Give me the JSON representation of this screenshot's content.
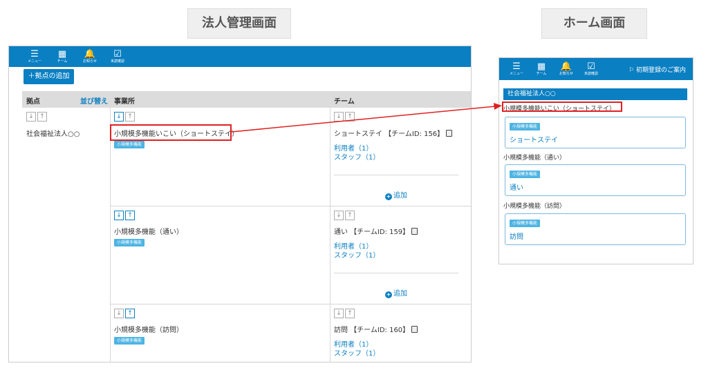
{
  "titles": {
    "corp_screen": "法人管理画面",
    "home_screen": "ホーム画面"
  },
  "topbar": {
    "items": [
      {
        "icon": "menu-icon",
        "glyph": "☰",
        "label": "メニュー"
      },
      {
        "icon": "team-grid-icon",
        "glyph": "▦",
        "label": "チーム"
      },
      {
        "icon": "bell-icon",
        "glyph": "🔔",
        "label": "お知らせ"
      },
      {
        "icon": "clipboard-check-icon",
        "glyph": "☑",
        "label": "未読確認"
      }
    ]
  },
  "corp": {
    "add_base_button": "＋拠点の追加",
    "headers": {
      "base": "拠点",
      "sort": "並び替え",
      "office": "事業所",
      "team": "チーム"
    },
    "base_name": "社会福祉法人○○",
    "arrow_down": "↓",
    "arrow_up": "↑",
    "facility_badge": "小規模多機能",
    "users_link": "利用者（1）",
    "staff_link": "スタッフ（1）",
    "add_label": "追加",
    "rows": [
      {
        "office": "小規模多機能いこい（ショートステイ）",
        "team": "ショートステイ 【チームID: 156】"
      },
      {
        "office": "小規模多機能（通い）",
        "team": "通い 【チームID: 159】"
      },
      {
        "office": "小規模多機能（訪問）",
        "team": "訪問 【チームID: 160】"
      }
    ]
  },
  "home": {
    "guide_link": "⚐ 初期登録のご案内",
    "corp_name": "社会福祉法人○○",
    "facilities": [
      {
        "name": "小規模多機能いこい（ショートステイ）",
        "badge": "小規模多機能",
        "team": "ショートステイ"
      },
      {
        "name": "小規模多機能（通い）",
        "badge": "小規模多機能",
        "team": "通い"
      },
      {
        "name": "小規模多機能（訪問）",
        "badge": "小規模多機能",
        "team": "訪問"
      }
    ]
  },
  "colors": {
    "brand_blue": "#0a7fc2",
    "badge_blue": "#4db4e3",
    "highlight_red": "#e02020"
  }
}
